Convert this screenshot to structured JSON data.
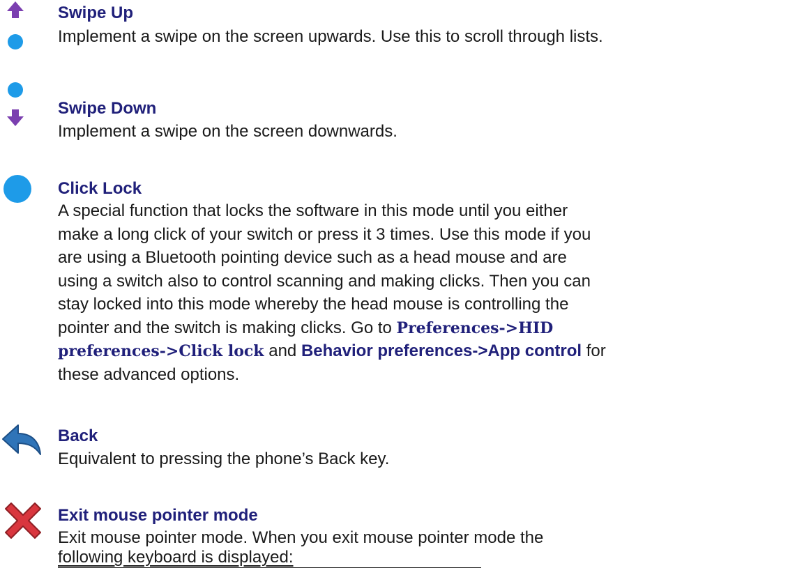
{
  "items": [
    {
      "title": "Swipe Up",
      "desc": "Implement a swipe on the screen upwards. Use this to scroll through lists.",
      "icon": "swipe-up-icon"
    },
    {
      "title": "Swipe Down",
      "desc": "Implement a swipe on the screen downwards.",
      "icon": "swipe-down-icon"
    },
    {
      "title": "Click Lock",
      "lines": [
        "A special function that locks the software in this mode until you either",
        "make a long click of your switch or press it 3 times. Use this mode if you",
        "are using a Bluetooth pointing device such as a head mouse and are",
        "using a switch also to control scanning and making clicks. Then you can",
        "stay locked into this mode whereby the head mouse is controlling the",
        "pointer and the switch is making clicks. Go to"
      ],
      "link1a": "Preferences->HID",
      "link1b": "preferences->Click lock",
      "and": "and",
      "link2": "Behavior preferences->App control",
      "for": "for",
      "last": "these advanced options.",
      "icon": "click-lock-icon"
    },
    {
      "title": "Back",
      "desc": "Equivalent to pressing the phone’s Back key.",
      "icon": "back-arrow-icon"
    },
    {
      "title": "Exit mouse pointer mode",
      "line1": "Exit mouse pointer mode. When you exit mouse pointer mode the",
      "line2": "following keyboard is displayed:",
      "icon": "exit-x-icon"
    }
  ],
  "colors": {
    "title": "#20207a",
    "dot": "#1e9be8",
    "arrow": "#7b3fb0",
    "back": "#2f74b8",
    "x": "#d9363e"
  }
}
